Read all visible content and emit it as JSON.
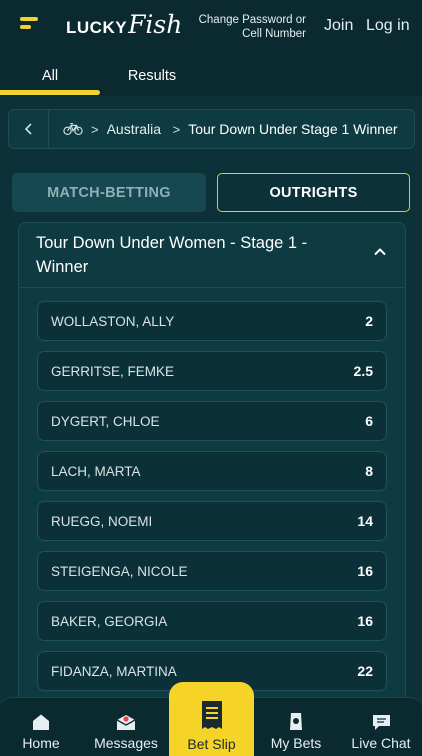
{
  "header": {
    "logo_lucky": "LUCKY",
    "logo_fish": "Fish",
    "change_password": "Change Password or Cell Number",
    "join": "Join",
    "login": "Log in"
  },
  "tabs": [
    {
      "label": "All",
      "active": true
    },
    {
      "label": "Results",
      "active": false
    }
  ],
  "breadcrumb": {
    "sport_icon": "bicycle-icon",
    "country": "Australia",
    "event": "Tour Down Under Stage 1 Winner"
  },
  "market_toggle": {
    "match_betting": "MATCH-BETTING",
    "outrights": "OUTRIGHTS",
    "active": "outrights"
  },
  "market": {
    "title": "Tour Down Under Women - Stage 1 - Winner",
    "expanded": true,
    "runners": [
      {
        "name": "WOLLASTON, ALLY",
        "odds": "2"
      },
      {
        "name": "GERRITSE, FEMKE",
        "odds": "2.5"
      },
      {
        "name": "DYGERT, CHLOE",
        "odds": "6"
      },
      {
        "name": "LACH, MARTA",
        "odds": "8"
      },
      {
        "name": "RUEGG, NOEMI",
        "odds": "14"
      },
      {
        "name": "STEIGENGA, NICOLE",
        "odds": "16"
      },
      {
        "name": "BAKER, GEORGIA",
        "odds": "16"
      },
      {
        "name": "FIDANZA, MARTINA",
        "odds": "22"
      }
    ]
  },
  "bottom_nav": {
    "home": "Home",
    "messages": "Messages",
    "bet_slip": "Bet Slip",
    "my_bets": "My Bets",
    "live_chat": "Live Chat"
  },
  "colors": {
    "background": "#0c3138",
    "accent": "#f2d22e",
    "panel": "#0e3a42"
  }
}
